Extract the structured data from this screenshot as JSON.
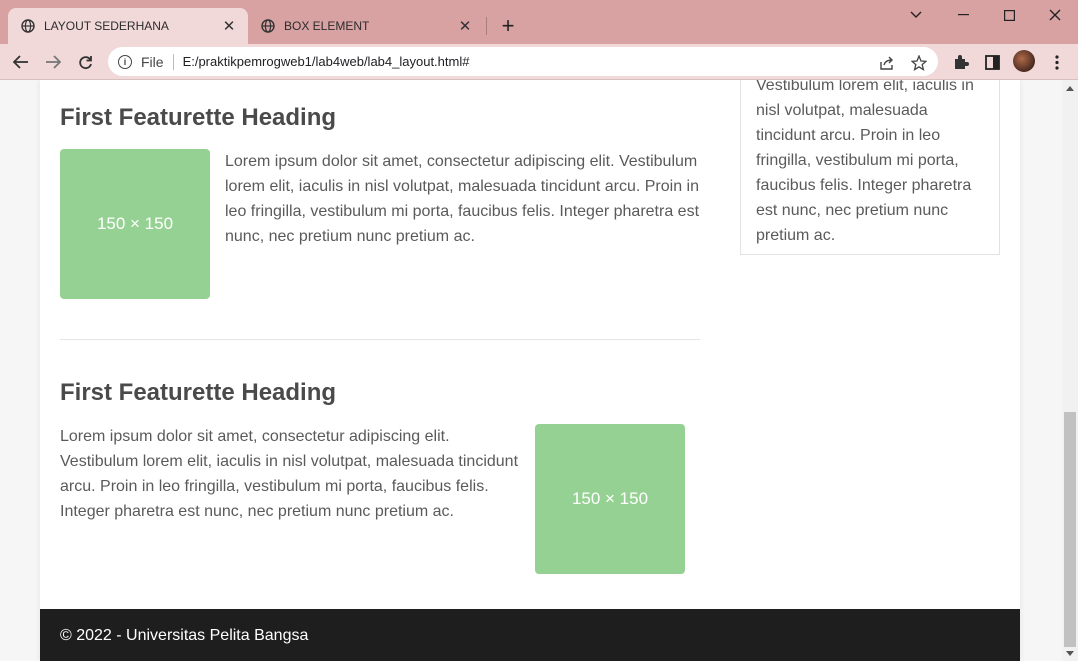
{
  "browser": {
    "tabs": [
      {
        "title": "LAYOUT SEDERHANA",
        "active": true
      },
      {
        "title": "BOX ELEMENT",
        "active": false
      }
    ],
    "new_tab": "+",
    "scheme": "File",
    "url": "E:/praktikpemrogweb1/lab4web/lab4_layout.html#",
    "window_controls": {
      "minimize": "—",
      "maximize": "☐",
      "close": "✕",
      "tab_search": "⌄"
    },
    "tab_close": "✕"
  },
  "page": {
    "sidebar_text": "Vestibulum lorem elit, iaculis in nisl volutpat, malesuada tincidunt arcu. Proin in leo fringilla, vestibulum mi porta, faucibus felis. Integer pharetra est nunc, nec pretium nunc pretium ac.",
    "featurettes": [
      {
        "heading": "First Featurette Heading",
        "image_label": "150 × 150",
        "text": "Lorem ipsum dolor sit amet, consectetur adipiscing elit. Vestibulum lorem elit, iaculis in nisl volutpat, malesuada tincidunt arcu. Proin in leo fringilla, vestibulum mi porta, faucibus felis. Integer pharetra est nunc, nec pretium nunc pretium ac."
      },
      {
        "heading": "First Featurette Heading",
        "image_label": "150 × 150",
        "text": "Lorem ipsum dolor sit amet, consectetur adipiscing elit. Vestibulum lorem elit, iaculis in nisl volutpat, malesuada tincidunt arcu. Proin in leo fringilla, vestibulum mi porta, faucibus felis. Integer pharetra est nunc, nec pretium nunc pretium ac."
      }
    ],
    "footer": "© 2022 - Universitas Pelita Bangsa"
  },
  "colors": {
    "titlebar": "#d8a1a2",
    "toolbar": "#f1d9da",
    "placeholder": "#96d194",
    "footer": "#1e1e1e"
  }
}
